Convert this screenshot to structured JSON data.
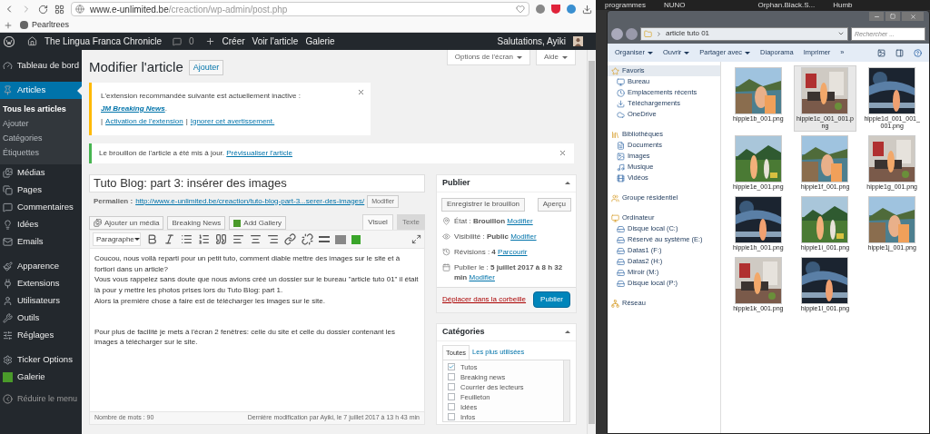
{
  "browser": {
    "url_host": "www.e-unlimited.be",
    "url_path": "/creaction/wp-admin/post.php",
    "bookmarks": [
      "Pearltrees"
    ]
  },
  "admin_bar": {
    "site": "The Lingua Franca Chronicle",
    "comments": "0",
    "create": "Créer",
    "links": [
      "Voir l'article",
      "Galerie"
    ],
    "greeting": "Salutations, Ayiki"
  },
  "sidebar": {
    "groups": [
      [
        {
          "label": "Tableau de bord",
          "selected": false
        }
      ],
      [
        {
          "label": "Articles",
          "selected": true,
          "children": [
            {
              "label": "Tous les articles",
              "selected": true
            },
            {
              "label": "Ajouter",
              "selected": false
            },
            {
              "label": "Catégories",
              "selected": false
            },
            {
              "label": "Étiquettes",
              "selected": false
            }
          ]
        },
        {
          "label": "Médias",
          "selected": false
        },
        {
          "label": "Pages",
          "selected": false
        },
        {
          "label": "Commentaires",
          "selected": false
        },
        {
          "label": "Idées",
          "selected": false
        },
        {
          "label": "Emails",
          "selected": false
        }
      ],
      [
        {
          "label": "Apparence",
          "selected": false
        },
        {
          "label": "Extensions",
          "selected": false
        },
        {
          "label": "Utilisateurs",
          "selected": false
        },
        {
          "label": "Outils",
          "selected": false
        },
        {
          "label": "Réglages",
          "selected": false
        }
      ],
      [
        {
          "label": "Ticker Options",
          "selected": false
        },
        {
          "label": "Galerie",
          "selected": false
        }
      ]
    ],
    "collapse": "Réduire le menu"
  },
  "screen_options": [
    "Options de l'écran",
    "Aide"
  ],
  "page": {
    "title": "Modifier l'article",
    "add_button": "Ajouter"
  },
  "notice_plugin": {
    "text": "L'extension recommandée suivante est actuellement inactive : ",
    "link": "JM Breaking News",
    "end": ".",
    "separator": "|",
    "actions": [
      "Activation de l'extension",
      "Ignorer cet avertissement."
    ]
  },
  "notice_saved": {
    "text": "Le brouillon de l'article a été mis à jour. ",
    "link": "Prévisualiser l'article"
  },
  "post": {
    "title": "Tuto Blog: part 3: insérer des images",
    "permalink_label": "Permalien :",
    "permalink": "http://www.e-unlimited.be/creaction/tuto-blog-part-3...serer-des-images/",
    "permalink_button": "Modifier",
    "media_buttons": [
      "Ajouter un média",
      "Breaking News",
      "Add Gallery"
    ],
    "editor_tabs": [
      {
        "label": "Visuel",
        "selected": true
      },
      {
        "label": "Texte",
        "selected": false
      }
    ],
    "format": "Paragraphe",
    "paragraphs": [
      [
        "Coucou, nous voilà reparti pour un petit tuto, comment diable mettre des images sur le site et à fortiori dans un article?",
        "Vous vous rappelez sans doute que nous avions créé un dossier sur le bureau \"article tuto 01\" il était là pour y mettre les photos prises lors du Tuto Blog: part 1.",
        "Alors la première chose à faire est de télécharger les images sur le site."
      ],
      [
        "Pour plus de facilité je mets à l'écran 2 fenêtres: celle du site et celle du dossier contenant les images à télécharger sur le site."
      ]
    ],
    "word_count": "Nombre de mots : 90",
    "last_modified": "Dernière modification par Ayiki, le 7 juillet 2017 à 13 h 43 min"
  },
  "publish": {
    "title": "Publier",
    "save_draft": "Enregistrer le brouillon",
    "preview": "Aperçu",
    "fields": [
      {
        "label": "État : ",
        "value": "Brouillon",
        "link": "Modifier"
      },
      {
        "label": "Visibilité : ",
        "value": "Public",
        "link": "Modifier"
      },
      {
        "label": "Révisions : ",
        "value": "4",
        "link": "Parcourir"
      },
      {
        "label": "Publier le : ",
        "value": "5 juillet 2017 à 8 h 32 min",
        "link": "Modifier"
      }
    ],
    "trash": "Déplacer dans la corbeille",
    "publish_button": "Publier"
  },
  "categories": {
    "title": "Catégories",
    "tabs": [
      {
        "label": "Toutes",
        "selected": true
      },
      {
        "label": "Les plus utilisées",
        "selected": false
      }
    ],
    "items": [
      {
        "label": "Tutos",
        "checked": true
      },
      {
        "label": "Breaking news",
        "checked": false
      },
      {
        "label": "Courrier des lecteurs",
        "checked": false
      },
      {
        "label": "Feuilleton",
        "checked": false
      },
      {
        "label": "Idées",
        "checked": false
      },
      {
        "label": "Infos",
        "checked": false
      }
    ]
  },
  "desktop_labels": [
    "programmes",
    "NUNO",
    "Orphan.Black.S...",
    "Humb"
  ],
  "explorer": {
    "address": "article tuto 01",
    "search_placeholder": "Rechercher ...",
    "toolbar": [
      {
        "label": "Organiser",
        "menu": true
      },
      {
        "label": "Ouvrir",
        "menu": true
      },
      {
        "label": "Partager avec",
        "menu": true
      },
      {
        "label": "Diaporama",
        "menu": false
      },
      {
        "label": "Imprimer",
        "menu": false
      },
      {
        "label": "»",
        "menu": false
      }
    ],
    "nav": [
      {
        "label": "Favoris",
        "selected": true,
        "children": [
          {
            "label": "Bureau"
          },
          {
            "label": "Emplacements récents"
          },
          {
            "label": "Téléchargements"
          },
          {
            "label": "OneDrive"
          }
        ]
      },
      {
        "label": "Bibliothèques",
        "selected": false,
        "children": [
          {
            "label": "Documents"
          },
          {
            "label": "Images"
          },
          {
            "label": "Musique"
          },
          {
            "label": "Vidéos"
          }
        ]
      },
      {
        "label": "Groupe résidentiel",
        "selected": false
      },
      {
        "label": "Ordinateur",
        "selected": false,
        "children": [
          {
            "label": "Disque local (C:)"
          },
          {
            "label": "Réservé au système (E:)"
          },
          {
            "label": "Datas1 (F:)"
          },
          {
            "label": "Datas2 (H:)"
          },
          {
            "label": "Miroir (M:)"
          },
          {
            "label": "Disque local (P:)"
          }
        ]
      },
      {
        "label": "Réseau",
        "selected": false
      }
    ],
    "files": [
      {
        "name": "hippie1b_001.png",
        "selected": false
      },
      {
        "name": "hippie1c_001_001.png",
        "selected": true
      },
      {
        "name": "hippie1d_001_001_001.png",
        "selected": false
      },
      {
        "name": "hippie1e_001.png",
        "selected": false
      },
      {
        "name": "hippie1f_001.png",
        "selected": false
      },
      {
        "name": "hippie1g_001.png",
        "selected": false
      },
      {
        "name": "hippie1h_001.png",
        "selected": false
      },
      {
        "name": "hippie1i_001.png",
        "selected": false
      },
      {
        "name": "hippie1j_001.png",
        "selected": false
      },
      {
        "name": "hippie1k_001.png",
        "selected": false
      },
      {
        "name": "hippie1l_001.png",
        "selected": false
      }
    ]
  }
}
